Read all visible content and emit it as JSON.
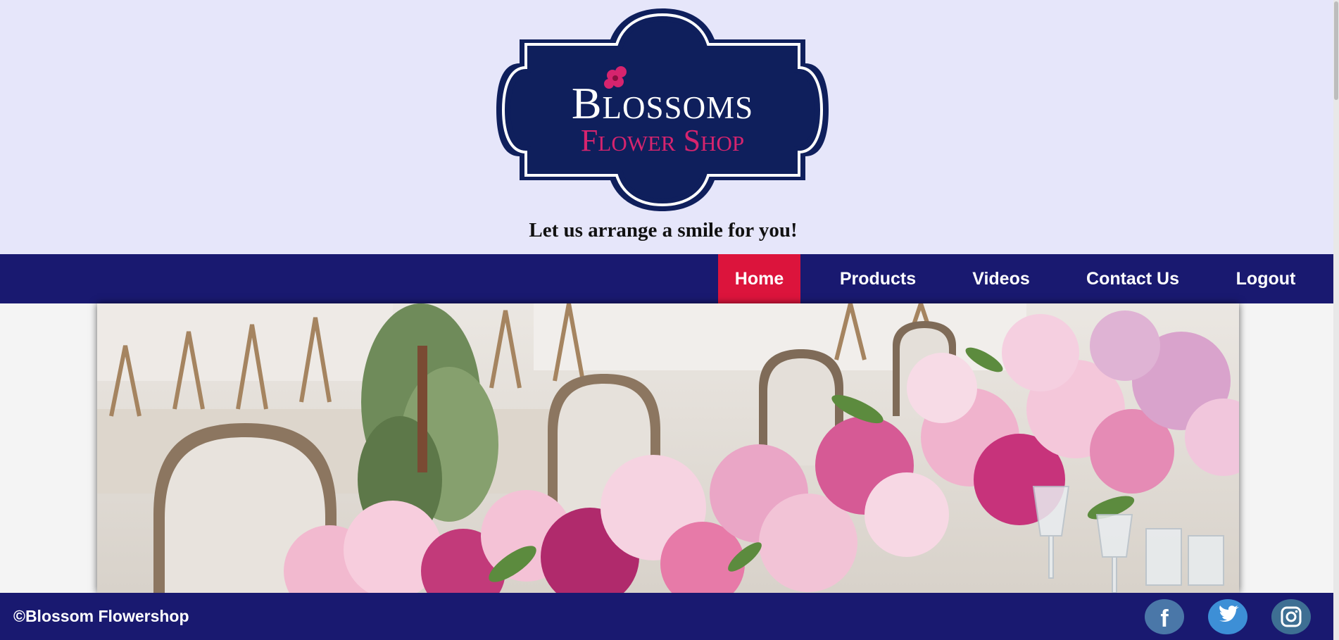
{
  "brand": {
    "logo_line1": "Blossoms",
    "logo_line2": "Flower Shop",
    "tagline": "Let us arrange a smile for you!"
  },
  "nav": {
    "items": [
      {
        "label": "Home",
        "active": true
      },
      {
        "label": "Products",
        "active": false
      },
      {
        "label": "Videos",
        "active": false
      },
      {
        "label": "Contact Us",
        "active": false
      },
      {
        "label": "Logout",
        "active": false
      }
    ]
  },
  "hero": {
    "image": "wedding-table-with-pink-flower-arrangement"
  },
  "footer": {
    "copyright": "©Blossom Flowershop",
    "social": [
      "facebook-icon",
      "twitter-icon",
      "instagram-icon"
    ]
  },
  "colors": {
    "header_bg": "#e6e6fa",
    "nav_bg": "#191970",
    "active_tab": "#dc143c",
    "logo_navy": "#0f1f5c",
    "logo_pink": "#d6246e",
    "social_bg": "#4a77a8"
  }
}
